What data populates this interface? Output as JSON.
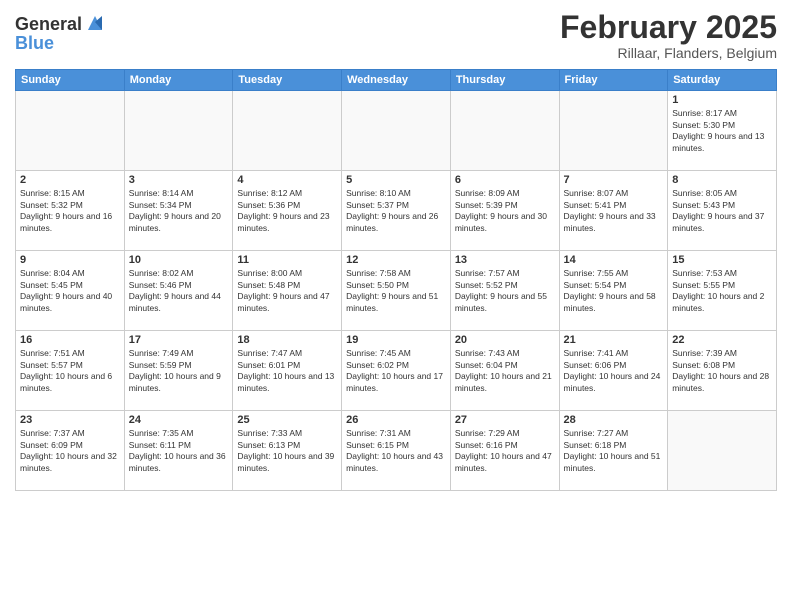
{
  "logo": {
    "general": "General",
    "blue": "Blue"
  },
  "header": {
    "title": "February 2025",
    "subtitle": "Rillaar, Flanders, Belgium"
  },
  "days_of_week": [
    "Sunday",
    "Monday",
    "Tuesday",
    "Wednesday",
    "Thursday",
    "Friday",
    "Saturday"
  ],
  "weeks": [
    [
      {
        "day": "",
        "info": ""
      },
      {
        "day": "",
        "info": ""
      },
      {
        "day": "",
        "info": ""
      },
      {
        "day": "",
        "info": ""
      },
      {
        "day": "",
        "info": ""
      },
      {
        "day": "",
        "info": ""
      },
      {
        "day": "1",
        "info": "Sunrise: 8:17 AM\nSunset: 5:30 PM\nDaylight: 9 hours and 13 minutes."
      }
    ],
    [
      {
        "day": "2",
        "info": "Sunrise: 8:15 AM\nSunset: 5:32 PM\nDaylight: 9 hours and 16 minutes."
      },
      {
        "day": "3",
        "info": "Sunrise: 8:14 AM\nSunset: 5:34 PM\nDaylight: 9 hours and 20 minutes."
      },
      {
        "day": "4",
        "info": "Sunrise: 8:12 AM\nSunset: 5:36 PM\nDaylight: 9 hours and 23 minutes."
      },
      {
        "day": "5",
        "info": "Sunrise: 8:10 AM\nSunset: 5:37 PM\nDaylight: 9 hours and 26 minutes."
      },
      {
        "day": "6",
        "info": "Sunrise: 8:09 AM\nSunset: 5:39 PM\nDaylight: 9 hours and 30 minutes."
      },
      {
        "day": "7",
        "info": "Sunrise: 8:07 AM\nSunset: 5:41 PM\nDaylight: 9 hours and 33 minutes."
      },
      {
        "day": "8",
        "info": "Sunrise: 8:05 AM\nSunset: 5:43 PM\nDaylight: 9 hours and 37 minutes."
      }
    ],
    [
      {
        "day": "9",
        "info": "Sunrise: 8:04 AM\nSunset: 5:45 PM\nDaylight: 9 hours and 40 minutes."
      },
      {
        "day": "10",
        "info": "Sunrise: 8:02 AM\nSunset: 5:46 PM\nDaylight: 9 hours and 44 minutes."
      },
      {
        "day": "11",
        "info": "Sunrise: 8:00 AM\nSunset: 5:48 PM\nDaylight: 9 hours and 47 minutes."
      },
      {
        "day": "12",
        "info": "Sunrise: 7:58 AM\nSunset: 5:50 PM\nDaylight: 9 hours and 51 minutes."
      },
      {
        "day": "13",
        "info": "Sunrise: 7:57 AM\nSunset: 5:52 PM\nDaylight: 9 hours and 55 minutes."
      },
      {
        "day": "14",
        "info": "Sunrise: 7:55 AM\nSunset: 5:54 PM\nDaylight: 9 hours and 58 minutes."
      },
      {
        "day": "15",
        "info": "Sunrise: 7:53 AM\nSunset: 5:55 PM\nDaylight: 10 hours and 2 minutes."
      }
    ],
    [
      {
        "day": "16",
        "info": "Sunrise: 7:51 AM\nSunset: 5:57 PM\nDaylight: 10 hours and 6 minutes."
      },
      {
        "day": "17",
        "info": "Sunrise: 7:49 AM\nSunset: 5:59 PM\nDaylight: 10 hours and 9 minutes."
      },
      {
        "day": "18",
        "info": "Sunrise: 7:47 AM\nSunset: 6:01 PM\nDaylight: 10 hours and 13 minutes."
      },
      {
        "day": "19",
        "info": "Sunrise: 7:45 AM\nSunset: 6:02 PM\nDaylight: 10 hours and 17 minutes."
      },
      {
        "day": "20",
        "info": "Sunrise: 7:43 AM\nSunset: 6:04 PM\nDaylight: 10 hours and 21 minutes."
      },
      {
        "day": "21",
        "info": "Sunrise: 7:41 AM\nSunset: 6:06 PM\nDaylight: 10 hours and 24 minutes."
      },
      {
        "day": "22",
        "info": "Sunrise: 7:39 AM\nSunset: 6:08 PM\nDaylight: 10 hours and 28 minutes."
      }
    ],
    [
      {
        "day": "23",
        "info": "Sunrise: 7:37 AM\nSunset: 6:09 PM\nDaylight: 10 hours and 32 minutes."
      },
      {
        "day": "24",
        "info": "Sunrise: 7:35 AM\nSunset: 6:11 PM\nDaylight: 10 hours and 36 minutes."
      },
      {
        "day": "25",
        "info": "Sunrise: 7:33 AM\nSunset: 6:13 PM\nDaylight: 10 hours and 39 minutes."
      },
      {
        "day": "26",
        "info": "Sunrise: 7:31 AM\nSunset: 6:15 PM\nDaylight: 10 hours and 43 minutes."
      },
      {
        "day": "27",
        "info": "Sunrise: 7:29 AM\nSunset: 6:16 PM\nDaylight: 10 hours and 47 minutes."
      },
      {
        "day": "28",
        "info": "Sunrise: 7:27 AM\nSunset: 6:18 PM\nDaylight: 10 hours and 51 minutes."
      },
      {
        "day": "",
        "info": ""
      }
    ]
  ]
}
